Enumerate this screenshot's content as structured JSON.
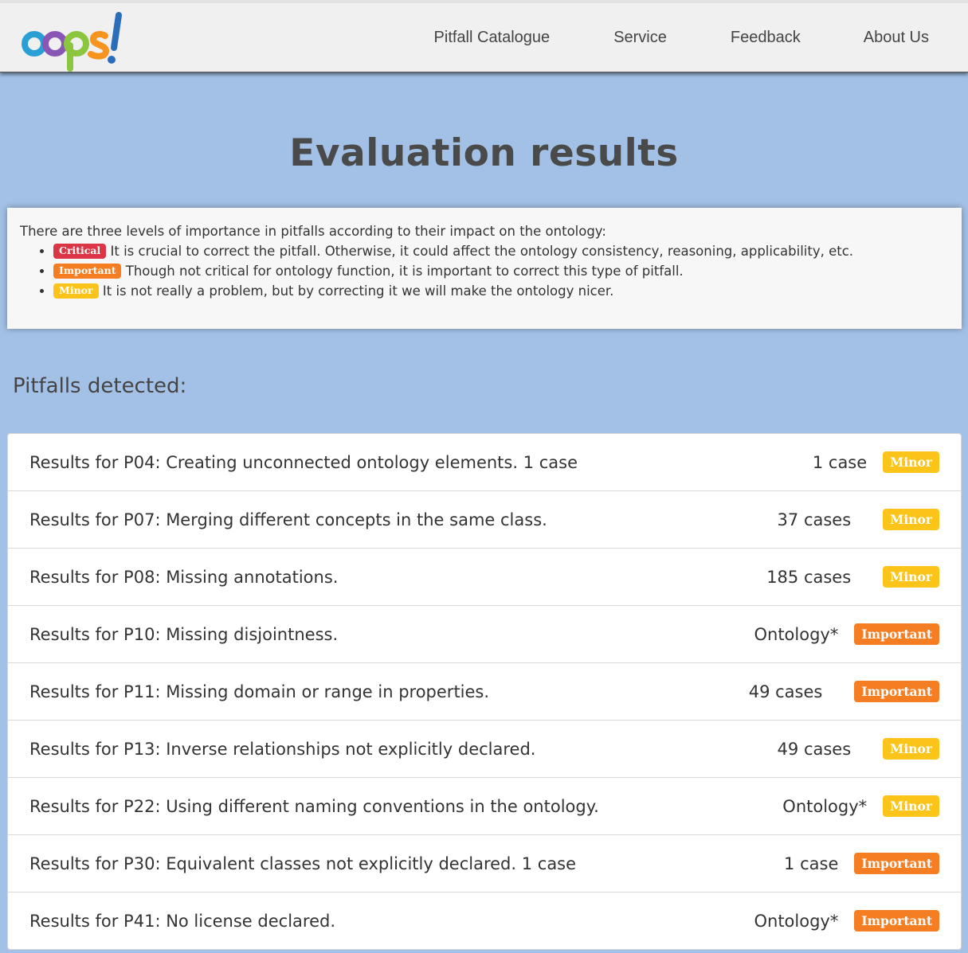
{
  "brand": {
    "logo_text": "oops!",
    "logo_colors": [
      "#2a9fd6",
      "#8a56b5",
      "#8cc63f",
      "#f7941d",
      "#2a6ebb"
    ]
  },
  "nav": {
    "items": [
      {
        "label": "Pitfall Catalogue"
      },
      {
        "label": "Service"
      },
      {
        "label": "Feedback"
      },
      {
        "label": "About Us"
      }
    ]
  },
  "page": {
    "title": "Evaluation results"
  },
  "legend": {
    "intro": "There are three levels of importance in pitfalls according to their impact on the ontology:",
    "levels": [
      {
        "badge": "Critical",
        "description": "It is crucial to correct the pitfall. Otherwise, it could affect the ontology consistency, reasoning, applicability, etc."
      },
      {
        "badge": "Important",
        "description": "Though not critical for ontology function, it is important to correct this type of pitfall."
      },
      {
        "badge": "Minor",
        "description": "It is not really a problem, but by correcting it we will make the ontology nicer."
      }
    ]
  },
  "pitfalls": {
    "heading": "Pitfalls detected:",
    "items": [
      {
        "title": "Results for P04: Creating unconnected ontology elements. 1 case",
        "count": "1 case",
        "level": "Minor"
      },
      {
        "title": "Results for P07: Merging different concepts in the same class.",
        "count": "37 cases",
        "level": "Minor"
      },
      {
        "title": "Results for P08: Missing annotations.",
        "count": "185 cases",
        "level": "Minor"
      },
      {
        "title": "Results for P10: Missing disjointness.",
        "count": "Ontology*",
        "level": "Important"
      },
      {
        "title": "Results for P11: Missing domain or range in properties.",
        "count": "49 cases",
        "level": "Important"
      },
      {
        "title": "Results for P13: Inverse relationships not explicitly declared.",
        "count": "49 cases",
        "level": "Minor"
      },
      {
        "title": "Results for P22: Using different naming conventions in the ontology.",
        "count": "Ontology*",
        "level": "Minor"
      },
      {
        "title": "Results for P30: Equivalent classes not explicitly declared. 1 case",
        "count": "1 case",
        "level": "Important"
      },
      {
        "title": "Results for P41: No license declared.",
        "count": "Ontology*",
        "level": "Important"
      }
    ]
  },
  "colors": {
    "background": "#a3c1e6",
    "critical": "#dc3545",
    "important": "#f67e22",
    "minor": "#fcc419"
  }
}
